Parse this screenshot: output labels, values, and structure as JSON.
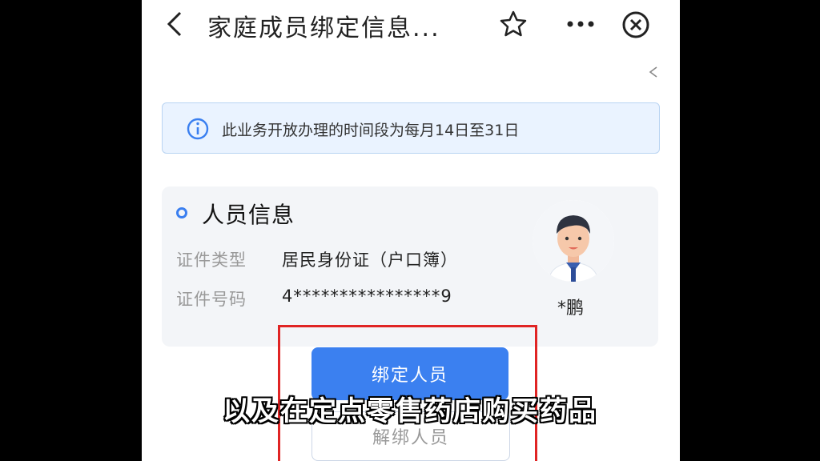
{
  "header": {
    "title": "家庭成员绑定信息..."
  },
  "notice": {
    "text": "此业务开放办理的时间段为每月14日至31日"
  },
  "person_info": {
    "section_title": "人员信息",
    "id_type_label": "证件类型",
    "id_type_value": "居民身份证（户口簿）",
    "id_number_label": "证件号码",
    "id_number_value": "4****************9",
    "name": "*鹏"
  },
  "buttons": {
    "bind_label": "绑定人员",
    "unbind_label": "解绑人员"
  },
  "subtitle": "以及在定点零售药店购买药品",
  "colors": {
    "accent": "#3b80f0",
    "notice_bg": "#eaf3ff",
    "highlight": "#e02424"
  },
  "icons": [
    "back-icon",
    "star-icon",
    "more-icon",
    "close-icon",
    "collapse-icon",
    "info-icon",
    "avatar"
  ]
}
